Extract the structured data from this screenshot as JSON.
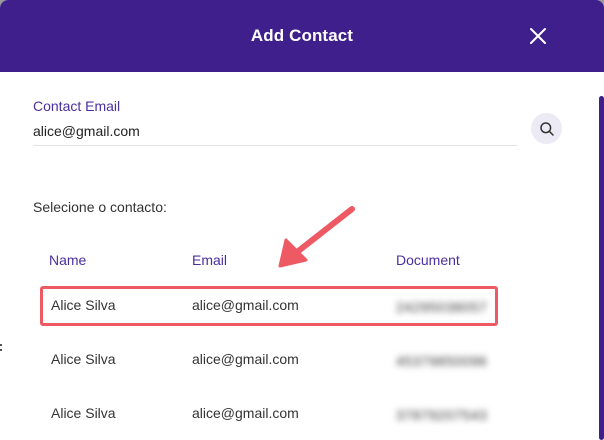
{
  "modal": {
    "title": "Add Contact",
    "close_icon": "close-icon"
  },
  "email_field": {
    "label": "Contact Email",
    "value": "alice@gmail.com",
    "search_icon": "search-icon"
  },
  "results": {
    "label": "Selecione o contacto:",
    "columns": [
      "Name",
      "Email",
      "Document"
    ],
    "rows": [
      {
        "name": "Alice Silva",
        "email": "alice@gmail.com",
        "document": "24295038057",
        "highlighted": true
      },
      {
        "name": "Alice Silva",
        "email": "alice@gmail.com",
        "document": "45379850096",
        "highlighted": false
      },
      {
        "name": "Alice Silva",
        "email": "alice@gmail.com",
        "document": "37879207543",
        "highlighted": false
      }
    ]
  },
  "colors": {
    "header_bg": "#3f1f8c",
    "accent": "#4a2fa0",
    "highlight_border": "#ee5a63",
    "annotation_arrow": "#ee5a63"
  }
}
